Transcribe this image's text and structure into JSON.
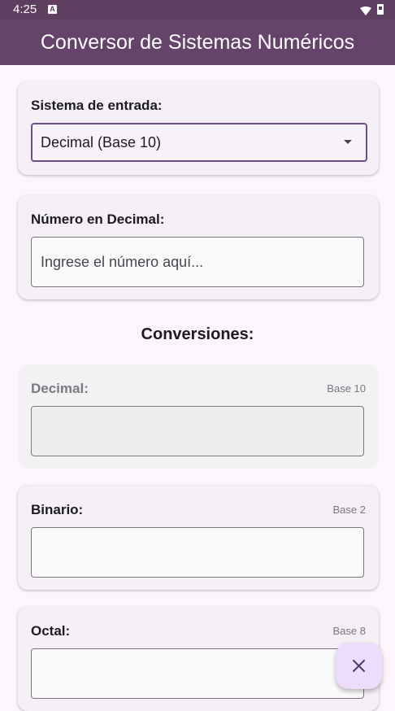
{
  "status_bar": {
    "time": "4:25",
    "notification_icon": "A"
  },
  "app_bar": {
    "title": "Conversor de Sistemas Numéricos"
  },
  "input_system": {
    "label": "Sistema de entrada:",
    "selected": "Decimal (Base 10)"
  },
  "number_input": {
    "label": "Número en Decimal:",
    "value": "",
    "placeholder": "Ingrese el número aquí..."
  },
  "conversions": {
    "title": "Conversiones:",
    "items": [
      {
        "label": "Decimal:",
        "base": "Base 10",
        "value": "",
        "disabled": true
      },
      {
        "label": "Binario:",
        "base": "Base 2",
        "value": ""
      },
      {
        "label": "Octal:",
        "base": "Base 8",
        "value": ""
      }
    ]
  },
  "fab": {
    "icon": "close-icon"
  }
}
